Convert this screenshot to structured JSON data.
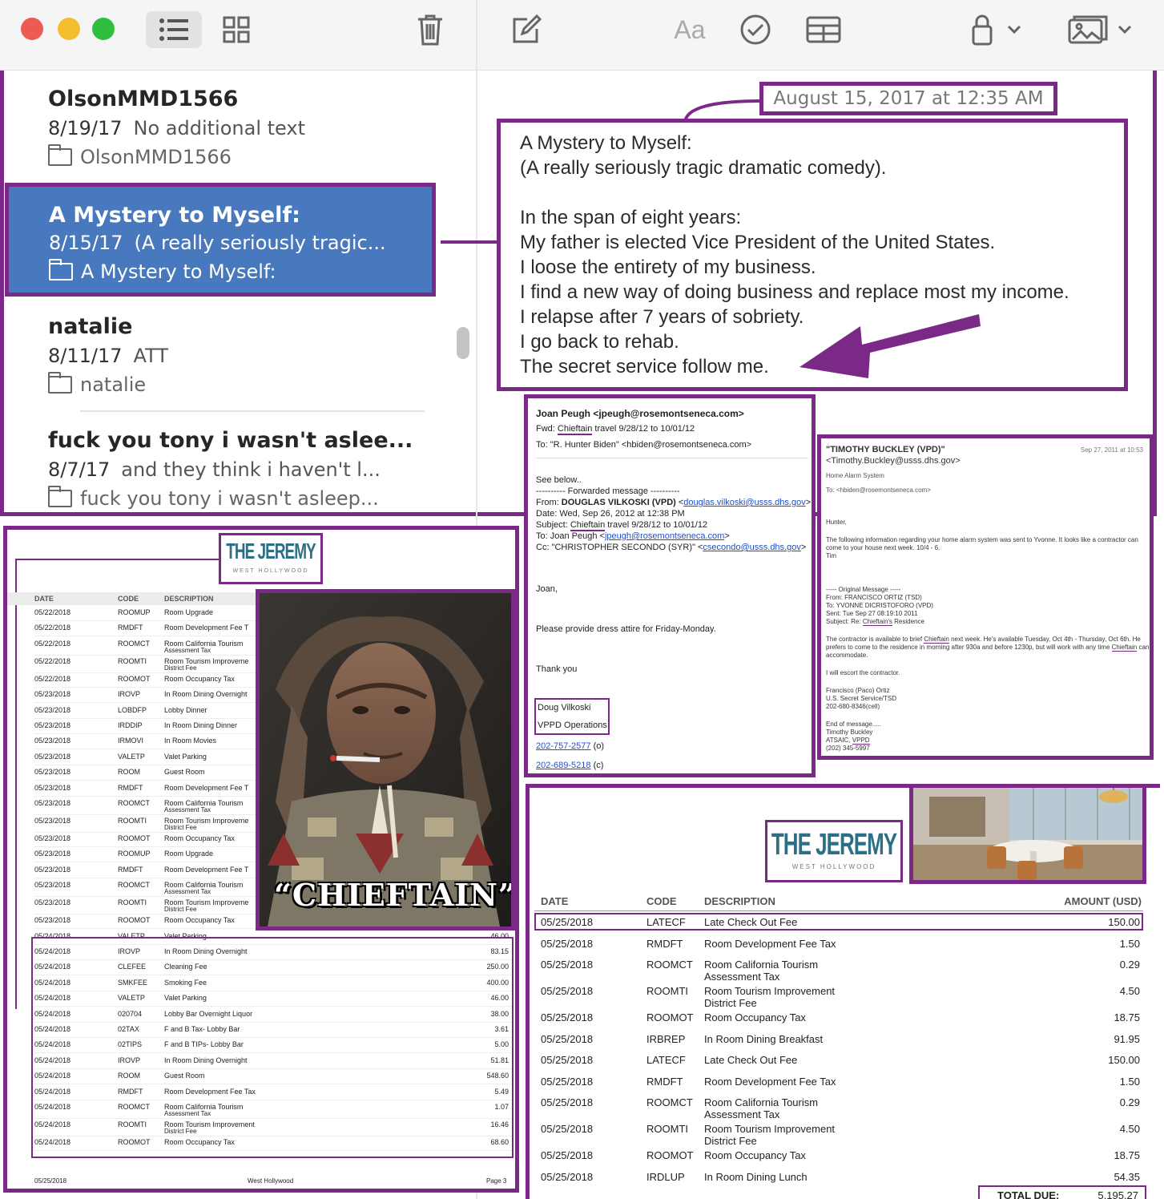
{
  "toolbar": {
    "icons": [
      "list-view-icon",
      "gallery-view-icon",
      "trash-icon",
      "compose-icon",
      "format-text-icon",
      "checklist-icon",
      "table-icon",
      "lock-icon",
      "media-icon"
    ],
    "format_label": "Aa"
  },
  "notes": [
    {
      "title": "OlsonMMD1566",
      "date": "8/19/17",
      "preview": "No additional text",
      "folder": "OlsonMMD1566"
    },
    {
      "title": "A Mystery to Myself:",
      "date": "8/15/17",
      "preview": "(A really seriously tragic...",
      "folder": "A Mystery to Myself:"
    },
    {
      "title": "natalie",
      "date": "8/11/17",
      "preview": "ATT",
      "folder": "natalie"
    },
    {
      "title": "fuck you tony i wasn't aslee...",
      "date": "8/7/17",
      "preview": "and they think i haven't l...",
      "folder": "fuck you tony i wasn't asleep..."
    }
  ],
  "note_detail": {
    "timestamp": "August 15, 2017 at 12:35 AM",
    "lines": [
      "A Mystery to Myself:",
      "(A really seriously tragic dramatic comedy).",
      "",
      "In the span of eight years:",
      "My father is elected Vice President of the United States.",
      "I loose the entirety of my business.",
      "I find a new way of doing business and replace most my income.",
      "I relapse after 7 years of sobriety.",
      "I go back to rehab.",
      "The secret service follow me."
    ]
  },
  "email1": {
    "from": "Joan Peugh <jpeugh@rosemontseneca.com>",
    "fwd_prefix": "Fwd:",
    "fwd_link": "Chieftain",
    "fwd_rest": "travel 9/28/12 to 10/01/12",
    "to": "To: \"R. Hunter Biden\" <hbiden@rosemontseneca.com>",
    "see_below": "See below..",
    "forwarded": "---------- Forwarded message ----------",
    "from_label": "From:",
    "from_name": "DOUGLAS VILKOSKI (VPD)",
    "from_email": "douglas.vilkoski@usss.dhs.gov",
    "date": "Date: Wed, Sep 26, 2012 at 12:38 PM",
    "subject_label": "Subject:",
    "subject_link": "Chieftain",
    "subject_rest": "travel 9/28/12 to 10/01/12",
    "to2_label": "To: Joan Peugh",
    "to2_email": "jpeugh@rosemontseneca.com",
    "cc_label": "Cc: \"CHRISTOPHER SECONDO (SYR)\"",
    "cc_email": "csecondo@usss.dhs.gov",
    "greeting": "Joan,",
    "body": "Please provide dress attire for Friday-Monday.",
    "thanks": "Thank you",
    "sig_name": "Doug Vilkoski",
    "sig_title": "VPPD Operations",
    "phone1": "202-757-2577",
    "phone1_suffix": "(o)",
    "phone2": "202-689-5218",
    "phone2_suffix": "(c)"
  },
  "email2": {
    "from": "\"TIMOTHY BUCKLEY (VPD)\"",
    "from_email": "<Timothy.Buckley@usss.dhs.gov>",
    "date": "Sep 27, 2011 at 10:53",
    "subject": "Home Alarm System",
    "to": "To: <hbiden@rosemontseneca.com>",
    "greet": "Hunter,",
    "p1": "The following information regarding your home alarm system was sent to Yvonne. It looks like a contractor can",
    "p1b": "come to your house next week. 10/4 - 6.",
    "p1c": "Tim",
    "orig": "----- Original Message -----",
    "orig_from": "From: FRANCISCO ORTIZ (TSD)",
    "orig_to": "To: YVONNE DICRISTOFORO (VPD)",
    "orig_sent": "Sent: Tue Sep 27 08:19:10 2011",
    "orig_subject_label": "Subject: Re:",
    "orig_subject_link": "Chieftain's",
    "orig_subject_rest": "Residence",
    "p2a": "The contractor is available to brief",
    "p2a_link": "Chieftain",
    "p2a_rest": "next week. He's available Tuesday, Oct 4th - Thursday, Oct 6th. He",
    "p2b_start": "prefers to come to the residence in morning after 930a and before 1230p, but will work with any time",
    "p2b_link": "Chieftain",
    "p2b_end": "can",
    "p2c": "accommodate.",
    "p3": "I will escort the contractor.",
    "sig1": "Francisco (Paco) Ortiz",
    "sig2": "U.S. Secret Service/TSD",
    "sig3": "202-680-8346(cell)",
    "end": "End of message.....",
    "sig4": "Timothy Buckley",
    "sig5_prefix": "ATSAIC,",
    "sig5_link": "VPPD",
    "sig6": "(202) 345-5997"
  },
  "invoice_left": {
    "logo_title": "THE JEREMY",
    "logo_sub": "WEST HOLLYWOOD",
    "headers": [
      "DATE",
      "CODE",
      "DESCRIPTION"
    ],
    "rows": [
      [
        "05/22/2018",
        "ROOMUP",
        "Room Upgrade",
        ""
      ],
      [
        "05/22/2018",
        "RMDFT",
        "Room Development Fee T",
        ""
      ],
      [
        "05/22/2018",
        "ROOMCT",
        "Room California Tourism",
        ""
      ],
      [
        "05/22/2018",
        "ROOMTI",
        "Room Tourism Improveme",
        ""
      ],
      [
        "05/22/2018",
        "ROOMOT",
        "Room Occupancy Tax",
        ""
      ],
      [
        "05/23/2018",
        "IROVP",
        "In Room Dining Overnight",
        ""
      ],
      [
        "05/23/2018",
        "LOBDFP",
        "Lobby Dinner",
        ""
      ],
      [
        "05/23/2018",
        "IRDDIP",
        "In Room Dining Dinner",
        ""
      ],
      [
        "05/23/2018",
        "IRMOVI",
        "In Room Movies",
        ""
      ],
      [
        "05/23/2018",
        "VALETP",
        "Valet Parking",
        ""
      ],
      [
        "05/23/2018",
        "ROOM",
        "Guest Room",
        ""
      ],
      [
        "05/23/2018",
        "RMDFT",
        "Room Development Fee T",
        ""
      ],
      [
        "05/23/2018",
        "ROOMCT",
        "Room California Tourism",
        ""
      ],
      [
        "05/23/2018",
        "ROOMTI",
        "Room Tourism Improveme",
        ""
      ],
      [
        "05/23/2018",
        "ROOMOT",
        "Room Occupancy Tax",
        ""
      ],
      [
        "05/23/2018",
        "ROOMUP",
        "Room Upgrade",
        ""
      ],
      [
        "05/23/2018",
        "RMDFT",
        "Room Development Fee T",
        ""
      ],
      [
        "05/23/2018",
        "ROOMCT",
        "Room California Tourism",
        ""
      ],
      [
        "05/23/2018",
        "ROOMTI",
        "Room Tourism Improveme",
        ""
      ],
      [
        "05/23/2018",
        "ROOMOT",
        "Room Occupancy Tax",
        ""
      ],
      [
        "05/24/2018",
        "VALETP",
        "Valet Parking",
        "46.00"
      ],
      [
        "05/24/2018",
        "IROVP",
        "In Room Dining Overnight",
        "83.15"
      ],
      [
        "05/24/2018",
        "CLEFEE",
        "Cleaning Fee",
        "250.00"
      ],
      [
        "05/24/2018",
        "SMKFEE",
        "Smoking Fee",
        "400.00"
      ],
      [
        "05/24/2018",
        "VALETP",
        "Valet Parking",
        "46.00"
      ],
      [
        "05/24/2018",
        "020704",
        "Lobby Bar Overnight Liquor",
        "38.00"
      ],
      [
        "05/24/2018",
        "02TAX",
        "F and B Tax- Lobby Bar",
        "3.61"
      ],
      [
        "05/24/2018",
        "02TIPS",
        "F and B TIPs- Lobby Bar",
        "5.00"
      ],
      [
        "05/24/2018",
        "IROVP",
        "In Room Dining Overnight",
        "51.81"
      ],
      [
        "05/24/2018",
        "ROOM",
        "Guest Room",
        "548.60"
      ],
      [
        "05/24/2018",
        "RMDFT",
        "Room Development Fee Tax",
        "5.49"
      ],
      [
        "05/24/2018",
        "ROOMCT",
        "Room California Tourism",
        "1.07"
      ],
      [
        "05/24/2018",
        "ROOMTI",
        "Room Tourism Improvement",
        "16.46"
      ],
      [
        "05/24/2018",
        "ROOMOT",
        "Room Occupancy Tax",
        "68.60"
      ]
    ],
    "subdesc": {
      "2": "Assessment Tax",
      "3": "District Fee",
      "12": "Assessment Tax",
      "13": "District Fee",
      "17": "Assessment Tax",
      "18": "District Fee",
      "31": "Assessment Tax",
      "32": "District Fee"
    },
    "footer_date": "05/25/2018",
    "footer_city": "West Hollywood",
    "footer_page": "Page 3",
    "photo_caption": "“CHIEFTAIN”"
  },
  "invoice_right": {
    "logo_title": "THE JEREMY",
    "logo_sub": "WEST HOLLYWOOD",
    "headers": [
      "DATE",
      "CODE",
      "DESCRIPTION",
      "AMOUNT (USD)"
    ],
    "rows": [
      [
        "05/25/2018",
        "LATECF",
        "Late Check Out Fee",
        "",
        "150.00"
      ],
      [
        "05/25/2018",
        "RMDFT",
        "Room Development Fee Tax",
        "",
        "1.50"
      ],
      [
        "05/25/2018",
        "ROOMCT",
        "Room California Tourism",
        "Assessment Tax",
        "0.29"
      ],
      [
        "05/25/2018",
        "ROOMTI",
        "Room Tourism Improvement",
        "District Fee",
        "4.50"
      ],
      [
        "05/25/2018",
        "ROOMOT",
        "Room Occupancy Tax",
        "",
        "18.75"
      ],
      [
        "05/25/2018",
        "IRBREP",
        "In Room Dining Breakfast",
        "",
        "91.95"
      ],
      [
        "05/25/2018",
        "LATECF",
        "Late Check Out Fee",
        "",
        "150.00"
      ],
      [
        "05/25/2018",
        "RMDFT",
        "Room Development Fee Tax",
        "",
        "1.50"
      ],
      [
        "05/25/2018",
        "ROOMCT",
        "Room California Tourism",
        "Assessment Tax",
        "0.29"
      ],
      [
        "05/25/2018",
        "ROOMTI",
        "Room Tourism Improvement",
        "District Fee",
        "4.50"
      ],
      [
        "05/25/2018",
        "ROOMOT",
        "Room Occupancy Tax",
        "",
        "18.75"
      ],
      [
        "05/25/2018",
        "IRDLUP",
        "In Room Dining Lunch",
        "",
        "54.35"
      ]
    ],
    "total_label": "TOTAL DUE:",
    "total_value": "5,195.27"
  },
  "colors": {
    "accent": "#7a2a86",
    "selected": "#4878bd",
    "link": "#1f4fc8",
    "teal": "#2f6f86"
  }
}
